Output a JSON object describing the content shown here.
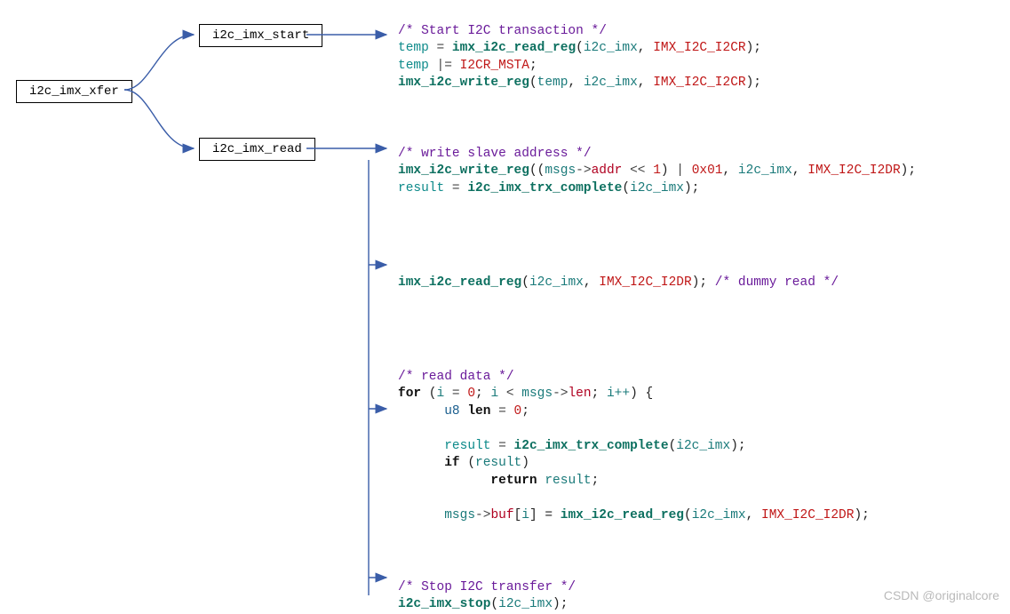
{
  "nodes": {
    "root": "i2c_imx_xfer",
    "child1": "i2c_imx_start",
    "child2": "i2c_imx_read"
  },
  "code": {
    "block1": {
      "comment": "/* Start I2C transaction */",
      "l1_var": "temp",
      "l1_eq": " = ",
      "l1_func": "imx_i2c_read_reg",
      "l1_arg1": "i2c_imx",
      "l1_arg2": "IMX_I2C_I2CR",
      "l2_var": "temp",
      "l2_op": " |= ",
      "l2_macro": "I2CR_MSTA",
      "l3_func": "imx_i2c_write_reg",
      "l3_arg1": "temp",
      "l3_arg2": "i2c_imx",
      "l3_arg3": "IMX_I2C_I2CR"
    },
    "block2": {
      "comment": "/* write slave address */",
      "l1_func": "imx_i2c_write_reg",
      "l1_msgs": "msgs",
      "l1_arrow": "->",
      "l1_addr": "addr",
      "l1_shift": " << ",
      "l1_one": "1",
      "l1_or": " | ",
      "l1_hex": "0x01",
      "l1_arg2": "i2c_imx",
      "l1_arg3": "IMX_I2C_I2DR",
      "l2_var": "result",
      "l2_eq": " = ",
      "l2_func": "i2c_imx_trx_complete",
      "l2_arg1": "i2c_imx"
    },
    "block3": {
      "func": "imx_i2c_read_reg",
      "arg1": "i2c_imx",
      "arg2": "IMX_I2C_I2DR",
      "comment": "/* dummy read */"
    },
    "block4": {
      "comment": "/* read data */",
      "for": "for",
      "i": "i",
      "eq": " = ",
      "zero": "0",
      "lt": " < ",
      "msgs": "msgs",
      "arrow": "->",
      "len": "len",
      "iplus": "i++",
      "u8": "u8",
      "lenvar": "len",
      "zero2": "0",
      "result": "result",
      "trx": "i2c_imx_trx_complete",
      "arg1": "i2c_imx",
      "if": "if",
      "ret": "return",
      "retval": "result",
      "buf": "buf",
      "idx": "i",
      "readfn": "imx_i2c_read_reg",
      "rarg1": "i2c_imx",
      "rarg2": "IMX_I2C_I2DR"
    },
    "block5": {
      "comment": "/* Stop I2C transfer */",
      "func": "i2c_imx_stop",
      "arg1": "i2c_imx"
    }
  },
  "watermark": "CSDN @originalcore"
}
